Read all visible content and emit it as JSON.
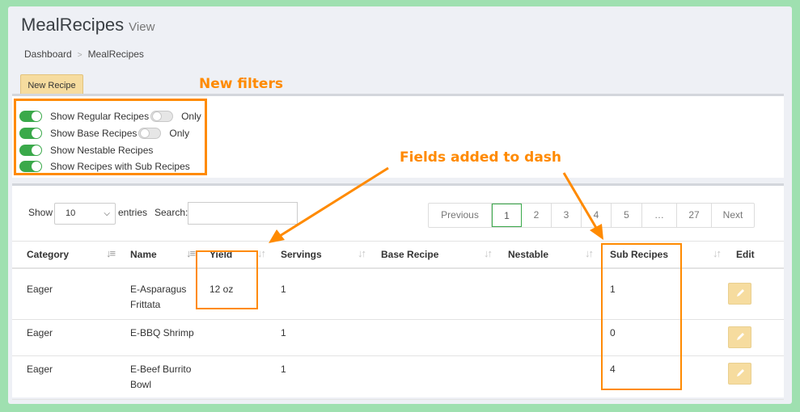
{
  "page": {
    "title": "MealRecipes",
    "subtitle": "View"
  },
  "breadcrumb": {
    "items": [
      "Dashboard",
      "MealRecipes"
    ],
    "separator": ">"
  },
  "toolbar": {
    "new_recipe": "New Recipe"
  },
  "annotations": {
    "new_filters": "New filters",
    "fields_added": "Fields added to dash",
    "accent_color": "#ff8a00"
  },
  "filters": [
    {
      "label": "Show Regular Recipes",
      "on": true,
      "only_label": "Only",
      "only_on": false
    },
    {
      "label": "Show Base Recipes",
      "on": true,
      "only_label": "Only",
      "only_on": false
    },
    {
      "label": "Show Nestable Recipes",
      "on": true
    },
    {
      "label": "Show Recipes with Sub Recipes",
      "on": true
    }
  ],
  "table_controls": {
    "show_label": "Show",
    "length_value": "10",
    "entries_label": "entries",
    "search_label": "Search:",
    "search_value": ""
  },
  "pagination": [
    "Previous",
    "1",
    "2",
    "3",
    "4",
    "5",
    "…",
    "27",
    "Next"
  ],
  "pagination_active": "1",
  "columns": [
    "Category",
    "Name",
    "Yield",
    "Servings",
    "Base Recipe",
    "Nestable",
    "Sub Recipes",
    "Edit"
  ],
  "rows": [
    {
      "category": "Eager",
      "name": "E-Asparagus Frittata",
      "yield": "12 oz",
      "servings": "1",
      "base_recipe": "",
      "nestable": "",
      "sub_recipes": "1"
    },
    {
      "category": "Eager",
      "name": "E-BBQ Shrimp",
      "yield": "",
      "servings": "1",
      "base_recipe": "",
      "nestable": "",
      "sub_recipes": "0"
    },
    {
      "category": "Eager",
      "name": "E-Beef Burrito Bowl",
      "yield": "",
      "servings": "1",
      "base_recipe": "",
      "nestable": "",
      "sub_recipes": "4"
    }
  ],
  "colors": {
    "toggle_on": "#3aa94a",
    "button": "#f6dc9f",
    "background": "#9fe0b0"
  }
}
